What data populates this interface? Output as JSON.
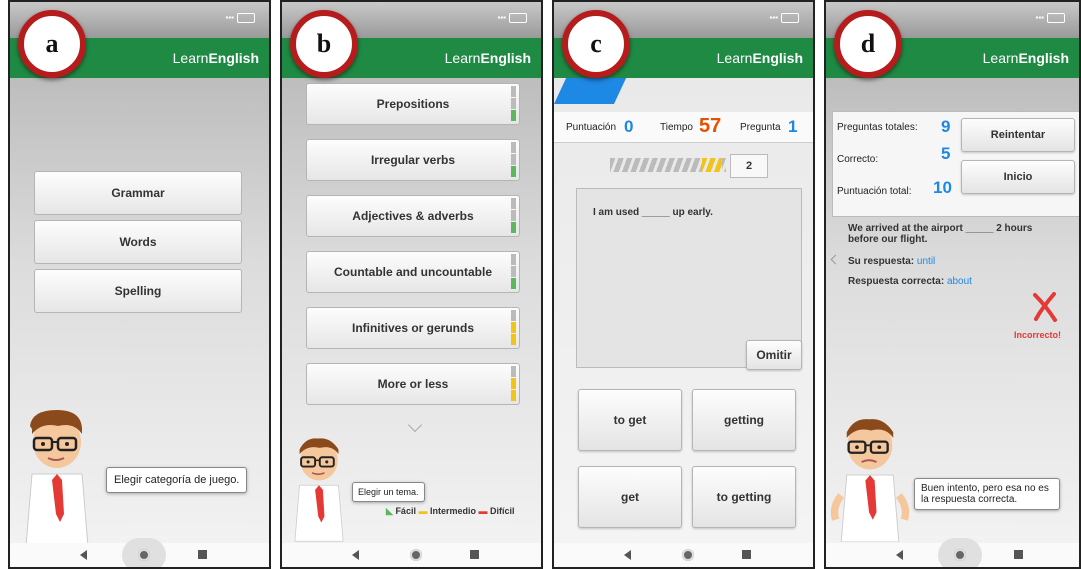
{
  "brand": {
    "light": "Learn",
    "bold": "English"
  },
  "screens": {
    "a": {
      "badge": "a",
      "categories": [
        "Grammar",
        "Words",
        "Spelling"
      ],
      "bubble": "Elegir categoría de juego."
    },
    "b": {
      "badge": "b",
      "topics": [
        {
          "label": "Prepositions",
          "level": "Fácil"
        },
        {
          "label": "Irregular verbs",
          "level": "Fácil"
        },
        {
          "label": "Adjectives & adverbs",
          "level": "Fácil"
        },
        {
          "label": "Countable and uncountable",
          "level": "Fácil"
        },
        {
          "label": "Infinitives or gerunds",
          "level": "Intermedio"
        },
        {
          "label": "More or less",
          "level": "Intermedio"
        }
      ],
      "bubble": "Elegir un tema.",
      "legend": {
        "easy": "Fácil",
        "mid": "Intermedio",
        "hard": "Difícil"
      },
      "colors": {
        "easy": "#5cb85c",
        "mid": "#f0c419",
        "hard": "#e53935"
      }
    },
    "c": {
      "badge": "c",
      "score_label": "Puntuación",
      "score": "0",
      "time_label": "Tiempo",
      "time": "57",
      "question_label": "Pregunta",
      "question": "1",
      "progress_box": "2",
      "question_text": "I am used _____ up early.",
      "skip": "Omitir",
      "answers": [
        "to get",
        "getting",
        "get",
        "to getting"
      ]
    },
    "d": {
      "badge": "d",
      "total_label": "Preguntas totales:",
      "total": "9",
      "correct_label": "Correcto:",
      "correct": "5",
      "score_label": "Puntuación total:",
      "score": "10",
      "retry": "Reintentar",
      "home": "Inicio",
      "question": "We arrived at the airport _____ 2 hours before our flight.",
      "your_answer_label": "Su respuesta:",
      "your_answer": "until",
      "correct_answer_label": "Respuesta correcta:",
      "correct_answer": "about",
      "verdict": "Incorrecto!",
      "bubble": "Buen intento, pero esa no es la respuesta correcta."
    }
  }
}
